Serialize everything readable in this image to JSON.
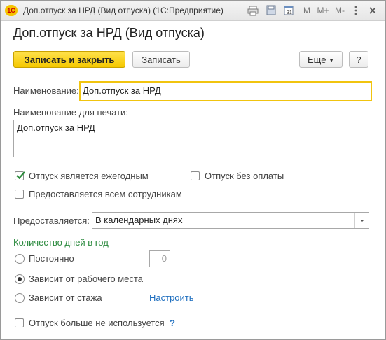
{
  "window": {
    "title": "Доп.отпуск за НРД (Вид отпуска)  (1С:Предприятие)",
    "logo_text": "1С",
    "toolbar": {
      "m_label": "M",
      "mplus_label": "M+",
      "mminus_label": "M-"
    }
  },
  "form": {
    "title": "Доп.отпуск за НРД (Вид отпуска)",
    "buttons": {
      "save_close": "Записать и закрыть",
      "save": "Записать",
      "more": "Еще",
      "help": "?"
    },
    "name": {
      "label": "Наименование:",
      "value": "Доп.отпуск за НРД"
    },
    "print_name": {
      "label": "Наименование для печати:",
      "value": "Доп.отпуск за НРД"
    },
    "checkboxes": {
      "annual": {
        "label": "Отпуск является ежегодным",
        "checked": true
      },
      "unpaid": {
        "label": "Отпуск без оплаты",
        "checked": false
      },
      "all_employees": {
        "label": "Предоставляется всем сотрудникам",
        "checked": false
      },
      "not_used": {
        "label": "Отпуск больше не используется",
        "checked": false
      }
    },
    "provided": {
      "label": "Предоставляется:",
      "value": "В календарных днях"
    },
    "days_per_year": {
      "heading": "Количество дней в год",
      "options": [
        {
          "label": "Постоянно",
          "selected": false
        },
        {
          "label": "Зависит от рабочего места",
          "selected": true
        },
        {
          "label": "Зависит от стажа",
          "selected": false
        }
      ],
      "constant_value": "0",
      "configure_link": "Настроить"
    },
    "help_mark": "?"
  }
}
